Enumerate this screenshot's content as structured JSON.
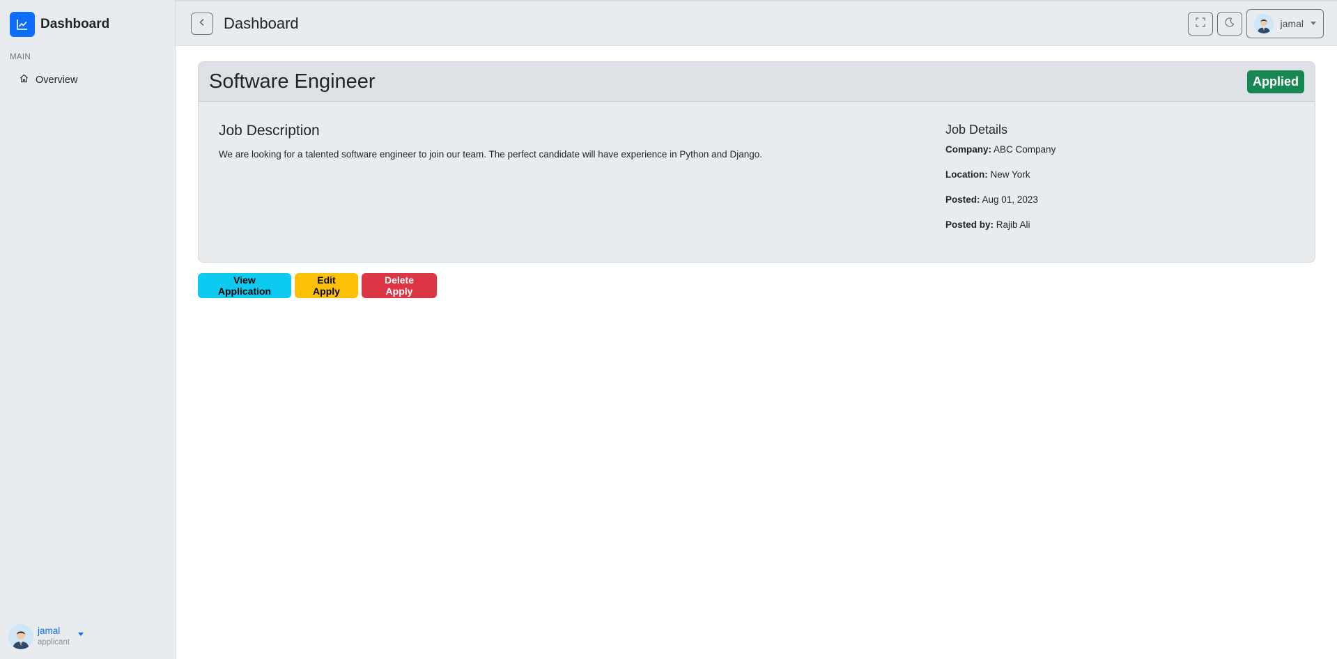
{
  "sidebar": {
    "brand_title": "Dashboard",
    "section_label": "MAIN",
    "nav_items": [
      {
        "label": "Overview",
        "icon": "home-icon"
      }
    ],
    "user": {
      "name": "jamal",
      "role": "applicant"
    }
  },
  "topbar": {
    "title": "Dashboard",
    "user_name": "jamal"
  },
  "job": {
    "title": "Software Engineer",
    "status": "Applied",
    "description_heading": "Job Description",
    "description": "We are looking for a talented software engineer to join our team. The perfect candidate will have experience in Python and Django.",
    "details_heading": "Job Details",
    "details": {
      "company_label": "Company:",
      "company": "ABC Company",
      "location_label": "Location:",
      "location": "New York",
      "posted_label": "Posted:",
      "posted": "Aug 01, 2023",
      "posted_by_label": "Posted by:",
      "posted_by": "Rajib Ali"
    }
  },
  "actions": {
    "view_label": "View Application",
    "edit_label": "Edit Apply",
    "delete_label": "Delete Apply"
  },
  "colors": {
    "primary": "#0d6efd",
    "success": "#198754",
    "info": "#0dcaf0",
    "warning": "#ffc107",
    "danger": "#dc3545"
  }
}
